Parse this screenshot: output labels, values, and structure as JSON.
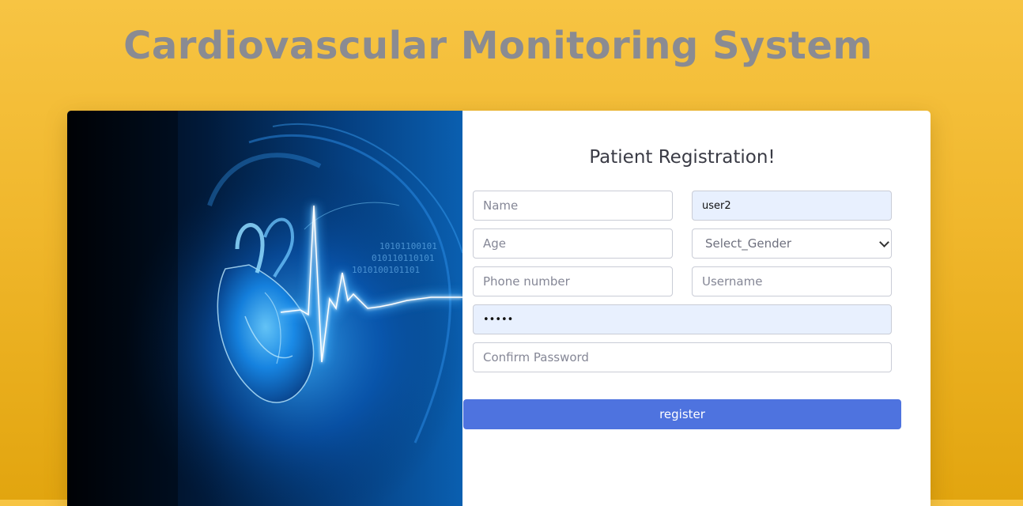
{
  "page": {
    "title": "Cardiovascular Monitoring System"
  },
  "hero": {
    "image": "heart-ecg-illustration"
  },
  "form": {
    "heading": "Patient Registration!",
    "name_placeholder": "Name",
    "email_value": "user2",
    "age_placeholder": "Age",
    "gender_selected": "Select_Gender",
    "phone_placeholder": "Phone number",
    "username_placeholder": "Username",
    "password_value": "•••••",
    "confirm_password_placeholder": "Confirm Password",
    "register_label": "register"
  },
  "colors": {
    "background": "#f3bd34",
    "title": "#8a8b92",
    "button": "#4e73df",
    "autofill": "#e8f0fe"
  }
}
